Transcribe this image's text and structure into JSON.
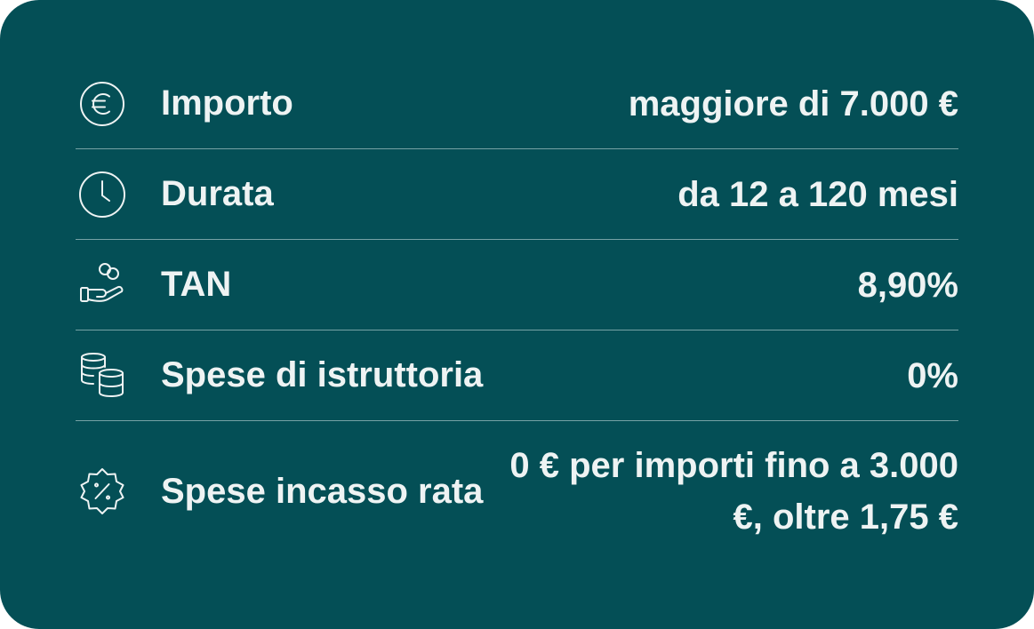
{
  "card": {
    "background_color": "#044f56",
    "text_color": "#eef3f3",
    "rows": [
      {
        "icon": "euro-circle-icon",
        "label": "Importo",
        "value": "maggiore di 7.000 €"
      },
      {
        "icon": "clock-icon",
        "label": "Durata",
        "value": "da 12 a 120 mesi"
      },
      {
        "icon": "hand-coins-icon",
        "label": "TAN",
        "value": "8,90%"
      },
      {
        "icon": "coin-stacks-icon",
        "label": "Spese di istruttoria",
        "value": "0%"
      },
      {
        "icon": "discount-badge-icon",
        "label": "Spese incasso rata",
        "value": "0 € per importi fino a 3.000 €, oltre 1,75 €"
      }
    ]
  }
}
